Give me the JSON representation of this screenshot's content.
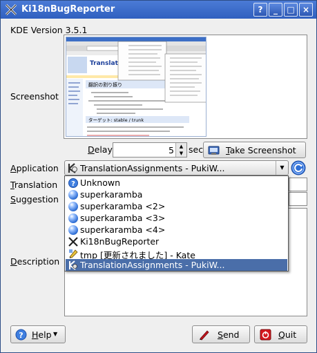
{
  "window": {
    "title": "Ki18nBugReporter",
    "buttons": {
      "help": "?",
      "minimize": "_",
      "maximize": "□",
      "close": "×"
    }
  },
  "kde_version": "KDE Version 3.5.1",
  "labels": {
    "screenshot": "Screenshot",
    "delay_pre": "",
    "delay_key": "D",
    "delay_rest": "elay",
    "sec": "sec",
    "application_key": "A",
    "application_rest": "pplication",
    "translation_key": "T",
    "translation_rest": "ranslation",
    "suggestion_key": "S",
    "suggestion_rest": "uggestion",
    "description_key": "D",
    "description_rest": "escription"
  },
  "delay": {
    "value": "5"
  },
  "take_screenshot": {
    "key": "T",
    "rest": "ake Screenshot"
  },
  "application_combo": {
    "selected": "TranslationAssignments - PukiW...",
    "options": [
      {
        "label": "Unknown",
        "icon": "help-circle-icon"
      },
      {
        "label": "superkaramba",
        "icon": "blue-ball-icon"
      },
      {
        "label": "superkaramba <2>",
        "icon": "blue-ball-icon"
      },
      {
        "label": "superkaramba <3>",
        "icon": "blue-ball-icon"
      },
      {
        "label": "superkaramba <4>",
        "icon": "blue-ball-icon"
      },
      {
        "label": "Ki18nBugReporter",
        "icon": "x-logo-icon"
      },
      {
        "label": "tmp [更新されました] - Kate",
        "icon": "kate-pen-icon"
      },
      {
        "label": "TranslationAssignments - PukiW...",
        "icon": "konqueror-gear-icon"
      }
    ]
  },
  "footer": {
    "help": {
      "key": "H",
      "rest": "elp"
    },
    "send": {
      "key": "S",
      "rest": "end"
    },
    "quit": {
      "key": "Q",
      "rest": "uit"
    }
  },
  "preview": {
    "heading": "Translation",
    "subheading": "翻訳の割り振り",
    "target": "ターゲット: stable / trunk"
  }
}
